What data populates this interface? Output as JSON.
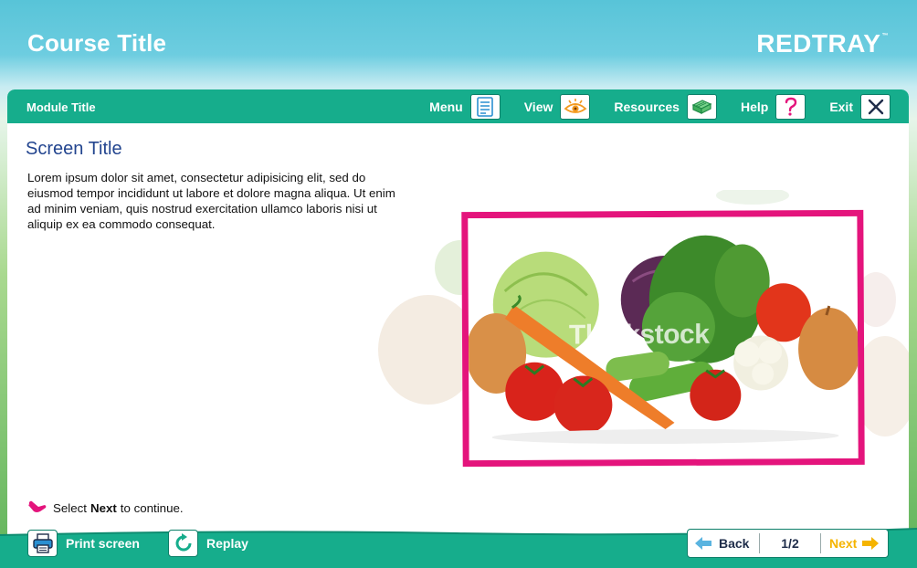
{
  "header": {
    "course_title": "Course Title",
    "logo": "REDTRAY",
    "logo_mark": "™"
  },
  "module_bar": {
    "module_title": "Module Title",
    "nav": [
      {
        "label": "Menu",
        "icon": "menu-icon"
      },
      {
        "label": "View",
        "icon": "eye-icon"
      },
      {
        "label": "Resources",
        "icon": "resources-icon"
      },
      {
        "label": "Help",
        "icon": "help-icon"
      },
      {
        "label": "Exit",
        "icon": "close-icon"
      }
    ]
  },
  "content": {
    "screen_title": "Screen Title",
    "body": "Lorem ipsum dolor sit amet, consectetur adipisicing elit, sed do eiusmod tempor incididunt ut labore et dolore magna aliqua. Ut enim ad minim veniam, quis nostrud exercitation ullamco laboris nisi ut aliquip ex ea commodo consequat.",
    "image_watermark": "Thinkstock",
    "instruction_pre": "Select",
    "instruction_bold": "Next",
    "instruction_post": "to continue."
  },
  "footer": {
    "print_label": "Print screen",
    "replay_label": "Replay",
    "back_label": "Back",
    "page_indicator": "1/2",
    "next_label": "Next"
  },
  "colors": {
    "accent_green": "#16ad8c",
    "frame_pink": "#e4147c",
    "title_blue": "#23458f",
    "next_yellow": "#f5b400"
  }
}
